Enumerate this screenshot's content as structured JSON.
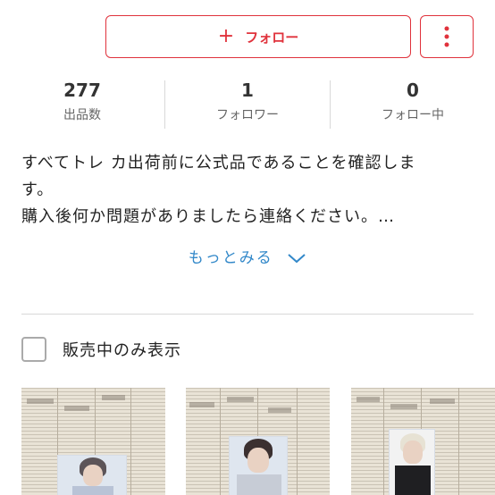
{
  "actions": {
    "follow_plus": "+",
    "follow_label": "フォロー",
    "more_icon": "vertical-ellipsis-icon"
  },
  "stats": [
    {
      "value": "277",
      "label": "出品数"
    },
    {
      "value": "1",
      "label": "フォロワー"
    },
    {
      "value": "0",
      "label": "フォロー中"
    }
  ],
  "bio": {
    "lines": [
      "すべてトレ カ出荷前に公式品であることを確認しま",
      "す。",
      "購入後何か問題がありましたら連絡ください。…"
    ]
  },
  "show_more": {
    "label": "もっとみる",
    "icon": "chevron-down-icon"
  },
  "filter": {
    "label": "販売中のみ表示",
    "checked": false
  },
  "listings": [
    {
      "image": "photocard-on-newspaper"
    },
    {
      "image": "photocard-on-newspaper"
    },
    {
      "image": "photocard-on-newspaper"
    }
  ],
  "colors": {
    "accent_red": "#e0323c",
    "link_blue": "#3288c9",
    "divider": "#d8d8d8"
  }
}
